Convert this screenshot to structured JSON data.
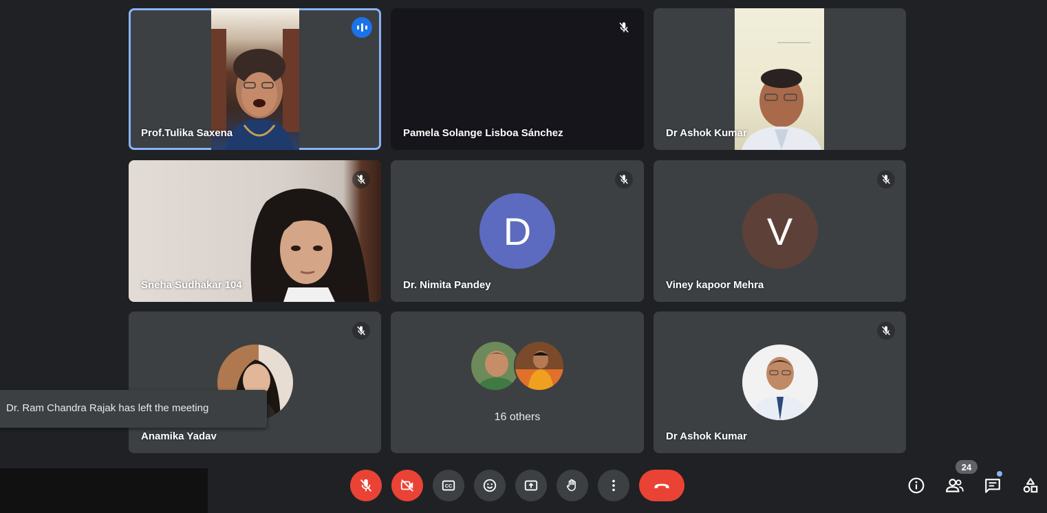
{
  "tiles": [
    {
      "name": "Prof.Tulika Saxena"
    },
    {
      "name": "Pamela Solange Lisboa Sánchez"
    },
    {
      "name": "Dr Ashok Kumar"
    },
    {
      "name": "Sneha Sudhakar 104"
    },
    {
      "name": "Dr. Nimita Pandey",
      "avatar_letter": "D",
      "avatar_color": "#5c6bc0"
    },
    {
      "name": "Viney kapoor Mehra",
      "avatar_letter": "V",
      "avatar_color": "#5d4037"
    },
    {
      "name": "Anamika Yadav"
    },
    {
      "name": "16 others"
    },
    {
      "name": "Dr Ashok Kumar"
    }
  ],
  "notification": {
    "text": "Dr. Ram Chandra Rajak has left the meeting"
  },
  "participants": {
    "count": "24"
  },
  "controls": {
    "mic": "microphone-off-icon",
    "camera": "camera-off-icon",
    "captions": "closed-captions-icon",
    "reactions": "emoji-icon",
    "present": "present-screen-icon",
    "raise_hand": "hand-icon",
    "more": "more-options-icon",
    "leave": "phone-hangup-icon"
  },
  "colors": {
    "background": "#202124",
    "tile": "#3c4043",
    "active_border": "#8ab4f8",
    "danger": "#ea4335",
    "speaking": "#1a73e8"
  }
}
